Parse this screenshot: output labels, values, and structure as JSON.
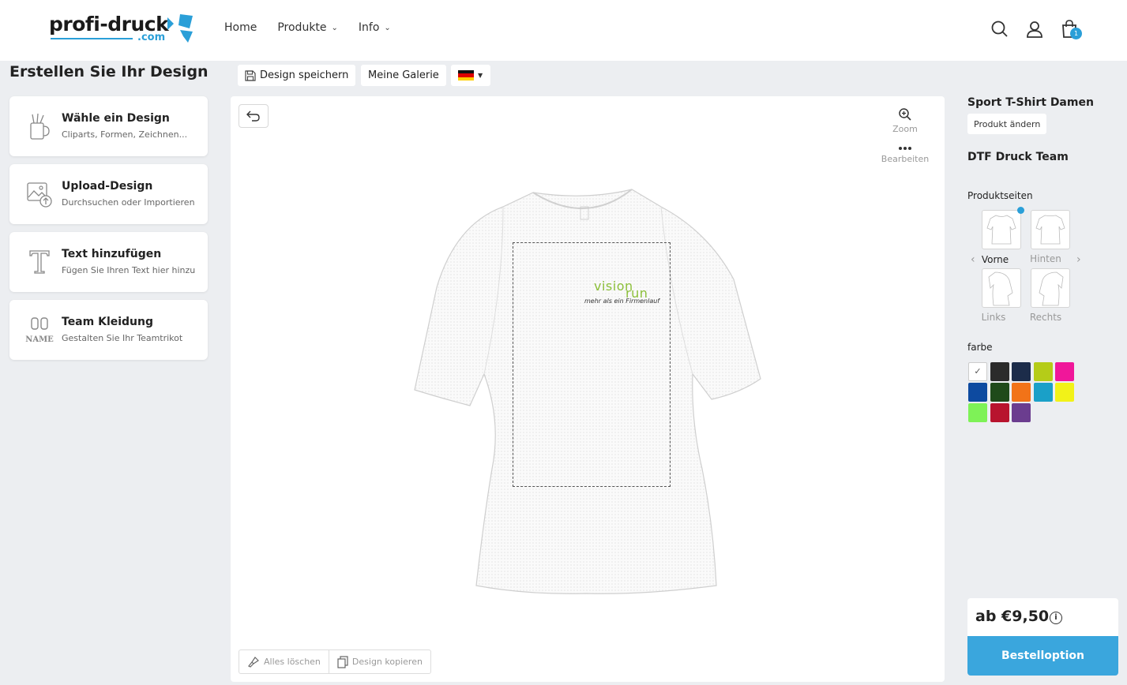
{
  "header": {
    "logo_text": "profi-druck",
    "logo_sub": ".com",
    "nav": [
      {
        "label": "Home"
      },
      {
        "label": "Produkte"
      },
      {
        "label": "Info"
      }
    ],
    "cart_count": "1"
  },
  "left": {
    "title": "Erstellen Sie Ihr Design",
    "tools": [
      {
        "title": "Wähle ein Design",
        "sub": "Cliparts, Formen, Zeichnen..."
      },
      {
        "title": "Upload-Design",
        "sub": "Durchsuchen oder Importieren"
      },
      {
        "title": "Text hinzufügen",
        "sub": "Fügen Sie Ihren Text hier hinzu"
      },
      {
        "title": "Team Kleidung",
        "sub": "Gestalten Sie Ihr Teamtrikot",
        "icon_label": "NAME"
      }
    ]
  },
  "toolbar": {
    "save": "Design speichern",
    "gallery": "Meine Galerie"
  },
  "canvas": {
    "zoom": "Zoom",
    "edit": "Bearbeiten",
    "design_line1": "vision",
    "design_line2": "run",
    "design_tagline": "mehr als ein Firmenlauf",
    "clear_all": "Alles löschen",
    "copy_design": "Design kopieren"
  },
  "right": {
    "product_name": "Sport T-Shirt Damen",
    "change_product": "Produkt ändern",
    "print_type": "DTF Druck Team",
    "sides_title": "Produktseiten",
    "sides": [
      {
        "label": "Vorne",
        "active": true
      },
      {
        "label": "Hinten"
      },
      {
        "label": "Links"
      },
      {
        "label": "Rechts"
      }
    ],
    "color_title": "farbe",
    "colors": [
      "#ffffff",
      "#2b2b2b",
      "#1c2c4a",
      "#b5cc18",
      "#f0179a",
      "#0d4aa0",
      "#1f4a1a",
      "#f27318",
      "#1aa0c8",
      "#f2f218",
      "#7ef257",
      "#b8142e",
      "#6b3d8f"
    ],
    "price": "ab €9,50",
    "order": "Bestelloption"
  }
}
